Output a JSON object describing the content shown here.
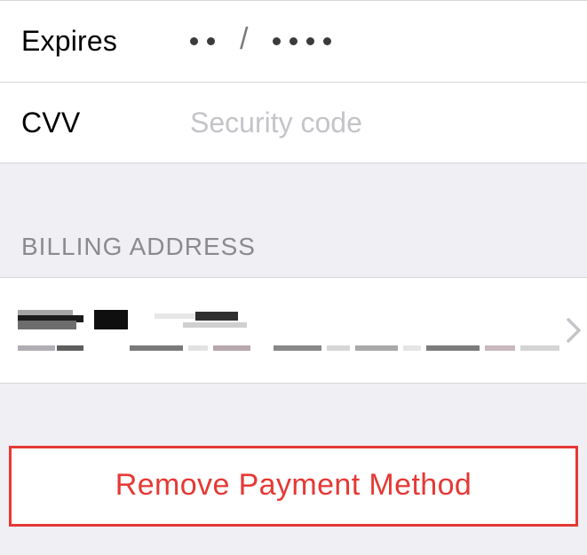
{
  "card_form": {
    "expires_label": "Expires",
    "expires_placeholder_month_dots": 2,
    "expires_placeholder_year_dots": 4,
    "expires_value": "",
    "cvv_label": "CVV",
    "cvv_placeholder": "Security code",
    "cvv_value": ""
  },
  "billing_address": {
    "section_title": "BILLING ADDRESS",
    "redacted": true,
    "line1": "",
    "line2": ""
  },
  "actions": {
    "remove_label": "Remove Payment Method"
  },
  "colors": {
    "accent_destructive": "#e53935",
    "section_bg": "#efeff4",
    "row_bg": "#ffffff",
    "separator": "#d8d8db",
    "secondary_text": "#8a8a8f"
  }
}
